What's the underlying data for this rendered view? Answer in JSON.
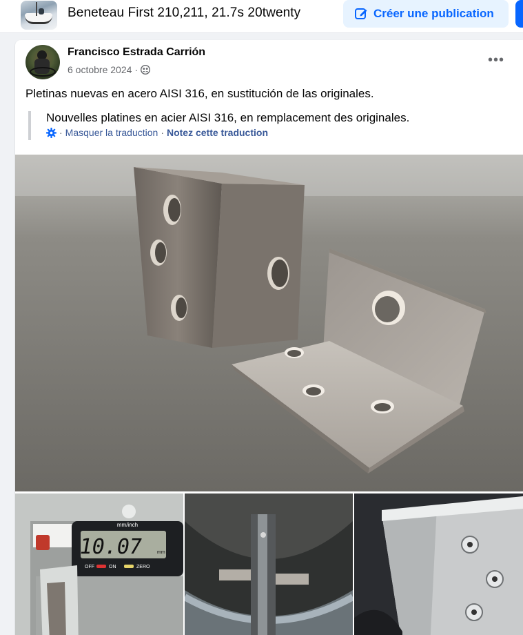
{
  "group": {
    "title": "Beneteau First 210,211, 21.7s 20twenty",
    "create_post_label": "Créer une publication"
  },
  "post": {
    "author": "Francisco Estrada Carrión",
    "date": "6 octobre 2024",
    "audience_icon": "members-icon",
    "more_icon": "more-options-icon",
    "more_glyph": "•••",
    "text": "Pletinas nuevas en acero AISI 316, en sustitución de las originales.",
    "translation": {
      "text": "Nouvelles platines en acier AISI 316, en remplacement des originales.",
      "hide_label": "Masquer la traduction",
      "rate_label": "Notez cette traduction",
      "separator": "·"
    }
  },
  "photos": {
    "caliper": {
      "units_label": "mm/inch",
      "reading": "10.07",
      "reading_unit": "mm",
      "off_label": "OFF",
      "on_label": "ON",
      "zero_label": "ZERO"
    }
  },
  "colors": {
    "accent": "#0866ff",
    "accent_soft": "#e7f3ff",
    "link": "#385898",
    "secondary_text": "#65676b"
  }
}
